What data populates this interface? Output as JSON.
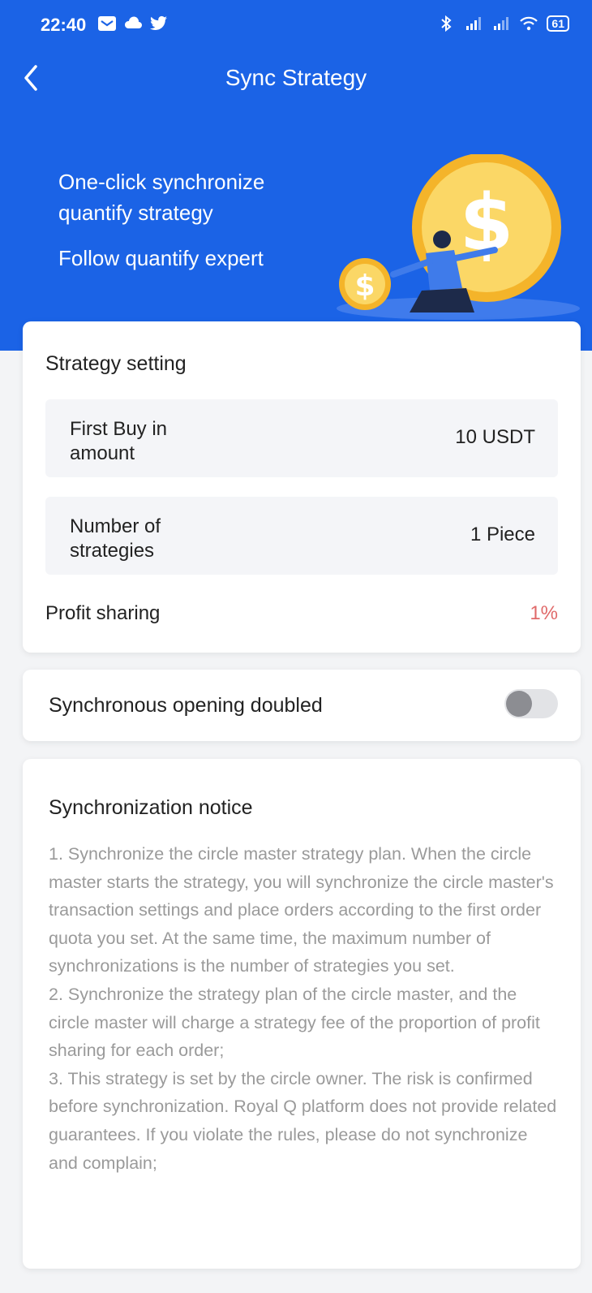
{
  "status_bar": {
    "time": "22:40",
    "left_icons": [
      "mail-icon",
      "cloud-icon",
      "twitter-icon"
    ],
    "right_icons": [
      "bluetooth-icon",
      "signal-icon",
      "signal-icon",
      "wifi-icon"
    ],
    "battery": "61"
  },
  "header": {
    "title": "Sync Strategy",
    "back_icon": "chevron-left-icon",
    "background": "#1b63e6"
  },
  "hero": {
    "line1": "One-click synchronize",
    "line2": "quantify strategy",
    "line3": "Follow quantify expert"
  },
  "strategy_setting": {
    "title": "Strategy setting",
    "first_buy": {
      "label": "First Buy in amount",
      "value": "10 USDT"
    },
    "strategies": {
      "label": "Number of strategies",
      "value": "1 Piece"
    },
    "profit": {
      "label": "Profit sharing",
      "value": "1%",
      "value_color": "#e06a6a"
    }
  },
  "toggle": {
    "label": "Synchronous opening doubled",
    "state": "off"
  },
  "notice": {
    "title": "Synchronization notice",
    "items": [
      "1. Synchronize the circle master strategy plan. When the circle master starts the strategy, you will synchronize the circle master's transaction settings and place orders according to the first order quota you set. At the same time, the maximum number of synchronizations is the number of strategies you set.",
      "2. Synchronize the strategy plan of the circle master, and the circle master will charge a strategy fee of the proportion of profit sharing for each order;",
      "3. This strategy is set by the circle owner. The risk is confirmed before synchronization. Royal Q platform does not provide related guarantees. If you violate the rules, please do not synchronize and complain;"
    ]
  }
}
